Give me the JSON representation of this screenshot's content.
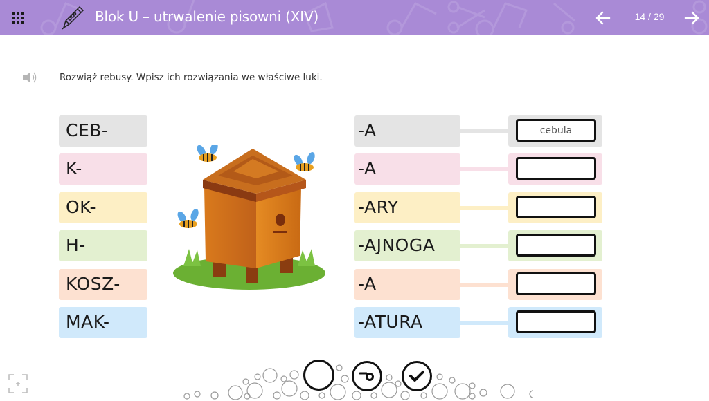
{
  "header": {
    "title": "Blok U – utrwalenie pisowni (XIV)",
    "page_counter": "14 / 29",
    "icons": {
      "menu": "grid-menu-icon",
      "logo": "pen-icon",
      "prev": "arrow-left-icon",
      "next": "arrow-right-icon"
    },
    "background_color": "#a98ad6"
  },
  "instruction": {
    "text": "Rozwiąż rebusy. Wpisz ich rozwiązania we właściwe luki.",
    "icon": "speaker-icon"
  },
  "rows": [
    {
      "left": "CEB-",
      "right": "-A",
      "answer": "cebula",
      "color": "#e4e4e4"
    },
    {
      "left": "K-",
      "right": "-A",
      "answer": "",
      "color": "#f8dfe8"
    },
    {
      "left": "OK-",
      "right": "-ARY",
      "answer": "",
      "color": "#fdefc5"
    },
    {
      "left": "H-",
      "right": "-AJNOGA",
      "answer": "",
      "color": "#e3f0d0"
    },
    {
      "left": "KOSZ-",
      "right": "-A",
      "answer": "",
      "color": "#fde1d1"
    },
    {
      "left": "MAK-",
      "right": "-ATURA",
      "answer": "",
      "color": "#d0e9fb"
    }
  ],
  "image": {
    "description": "beehive-with-bees",
    "icon": "beehive-illustration"
  },
  "controls": {
    "reset": "reset-button",
    "show_solution": "key-icon",
    "check": "checkmark-icon",
    "fullscreen": "fullscreen-icon"
  }
}
